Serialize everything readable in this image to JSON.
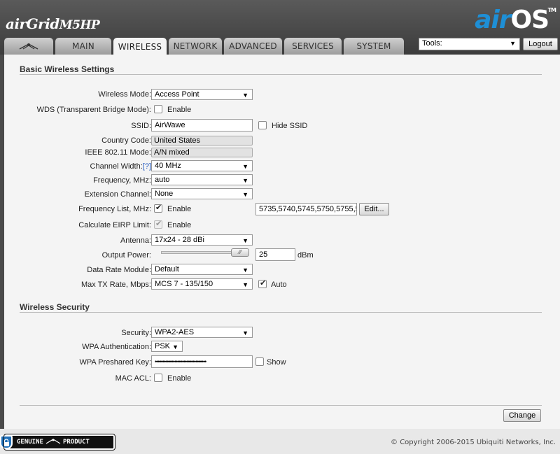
{
  "header": {
    "product_name": "airGrid",
    "product_model": "M5HP",
    "os_brand_air": "air",
    "os_brand_os": "OS",
    "tm": "TM"
  },
  "tabs": [
    {
      "label": "",
      "icon": "ubnt-logo-icon"
    },
    {
      "label": "MAIN"
    },
    {
      "label": "WIRELESS",
      "active": true
    },
    {
      "label": "NETWORK"
    },
    {
      "label": "ADVANCED"
    },
    {
      "label": "SERVICES"
    },
    {
      "label": "SYSTEM"
    }
  ],
  "tools": {
    "label": "Tools:",
    "logout": "Logout"
  },
  "basic": {
    "title": "Basic Wireless Settings",
    "wireless_mode": {
      "label": "Wireless Mode:",
      "value": "Access Point"
    },
    "wds": {
      "label": "WDS (Transparent Bridge Mode):",
      "option": "Enable",
      "checked": false
    },
    "ssid": {
      "label": "SSID:",
      "value": "AirWawe",
      "hide_label": "Hide SSID",
      "hide_checked": false
    },
    "country": {
      "label": "Country Code:",
      "value": "United States"
    },
    "ieee": {
      "label": "IEEE 802.11 Mode:",
      "value": "A/N mixed"
    },
    "channel_width": {
      "label": "Channel Width:",
      "help": "[?]",
      "value": "40 MHz"
    },
    "frequency": {
      "label": "Frequency, MHz:",
      "value": "auto"
    },
    "extension": {
      "label": "Extension Channel:",
      "value": "None"
    },
    "freq_list": {
      "label": "Frequency List, MHz:",
      "option": "Enable",
      "checked": true,
      "value": "5735,5740,5745,5750,5755,5",
      "edit": "Edit..."
    },
    "eirp": {
      "label": "Calculate EIRP Limit:",
      "option": "Enable",
      "checked": true
    },
    "antenna": {
      "label": "Antenna:",
      "value": "17x24 - 28 dBi"
    },
    "output_power": {
      "label": "Output Power:",
      "value": "25",
      "unit": "dBm",
      "level": 1.0
    },
    "data_rate": {
      "label": "Data Rate Module:",
      "value": "Default"
    },
    "max_tx": {
      "label": "Max TX Rate, Mbps:",
      "value": "MCS 7 - 135/150",
      "auto": "Auto",
      "auto_checked": true
    }
  },
  "security": {
    "title": "Wireless Security",
    "security": {
      "label": "Security:",
      "value": "WPA2-AES"
    },
    "wpa_auth": {
      "label": "WPA Authentication:",
      "value": "PSK"
    },
    "wpa_key": {
      "label": "WPA Preshared Key:",
      "value": "••••••••••••••••••••••••••••••••••",
      "show": "Show",
      "show_checked": false
    },
    "mac_acl": {
      "label": "MAC ACL:",
      "option": "Enable",
      "checked": false
    }
  },
  "change_button": "Change",
  "footer": {
    "genuine": "GENUINE",
    "product": "PRODUCT",
    "copyright": "© Copyright 2006-2015 Ubiquiti Networks, Inc."
  }
}
